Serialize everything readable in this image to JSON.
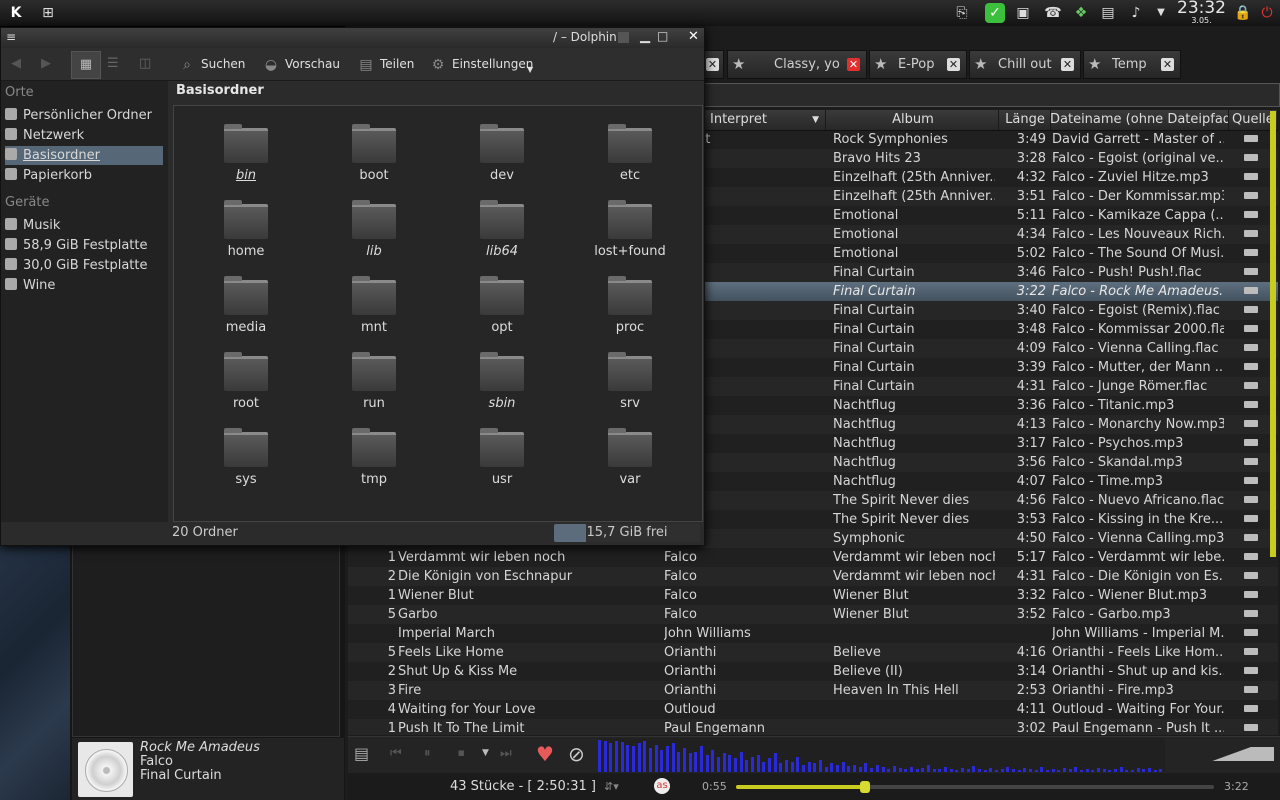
{
  "panel": {
    "clock_time": "23:32",
    "clock_date": "3.05."
  },
  "player": {
    "tabs": [
      {
        "label": "Classy, yo",
        "close_red": true
      },
      {
        "label": "E-Pop",
        "close_red": false
      },
      {
        "label": "Chill out",
        "close_red": false
      },
      {
        "label": "Temp",
        "close_red": false
      }
    ],
    "columns": {
      "artist": "Interpret",
      "album": "Album",
      "length": "Länge",
      "filename": "Dateiname (ohne Dateipfad)",
      "source": "Quelle"
    },
    "rows": [
      {
        "n": "",
        "title": "",
        "artist": "Garrett",
        "album": "Rock Symphonies",
        "len": "3:49",
        "file": "David Garrett - Master of ..."
      },
      {
        "n": "",
        "title": "",
        "artist": "",
        "album": "Bravo Hits 23",
        "len": "3:28",
        "file": "Falco - Egoist (original ve..."
      },
      {
        "n": "",
        "title": "",
        "artist": "",
        "album": "Einzelhaft (25th Anniver...",
        "len": "4:32",
        "file": "Falco - Zuviel Hitze.mp3"
      },
      {
        "n": "",
        "title": "",
        "artist": "",
        "album": "Einzelhaft (25th Anniver...",
        "len": "3:51",
        "file": "Falco - Der Kommissar.mp3"
      },
      {
        "n": "",
        "title": "",
        "artist": "",
        "album": "Emotional",
        "len": "5:11",
        "file": "Falco - Kamikaze Cappa (..."
      },
      {
        "n": "",
        "title": "",
        "artist": "",
        "album": "Emotional",
        "len": "4:34",
        "file": "Falco - Les Nouveaux Rich..."
      },
      {
        "n": "",
        "title": "",
        "artist": "",
        "album": "Emotional",
        "len": "5:02",
        "file": "Falco - The Sound Of Musi..."
      },
      {
        "n": "",
        "title": "",
        "artist": "",
        "album": "Final Curtain",
        "len": "3:46",
        "file": "Falco - Push! Push!.flac"
      },
      {
        "n": "",
        "title": "",
        "artist": "",
        "album": "Final Curtain",
        "len": "3:22",
        "file": "Falco - Rock Me Amadeus.f...",
        "current": true
      },
      {
        "n": "",
        "title": "",
        "artist": "",
        "album": "Final Curtain",
        "len": "3:40",
        "file": "Falco - Egoist (Remix).flac"
      },
      {
        "n": "",
        "title": "",
        "artist": "",
        "album": "Final Curtain",
        "len": "3:48",
        "file": "Falco - Kommissar 2000.flac"
      },
      {
        "n": "",
        "title": "",
        "artist": "",
        "album": "Final Curtain",
        "len": "4:09",
        "file": "Falco - Vienna Calling.flac"
      },
      {
        "n": "",
        "title": "",
        "artist": "",
        "album": "Final Curtain",
        "len": "3:39",
        "file": "Falco - Mutter, der Mann ..."
      },
      {
        "n": "",
        "title": "",
        "artist": "",
        "album": "Final Curtain",
        "len": "4:31",
        "file": "Falco - Junge Römer.flac"
      },
      {
        "n": "",
        "title": "",
        "artist": "",
        "album": "Nachtflug",
        "len": "3:36",
        "file": "Falco - Titanic.mp3"
      },
      {
        "n": "",
        "title": "",
        "artist": "",
        "album": "Nachtflug",
        "len": "4:13",
        "file": "Falco - Monarchy Now.mp3"
      },
      {
        "n": "",
        "title": "",
        "artist": "",
        "album": "Nachtflug",
        "len": "3:17",
        "file": "Falco - Psychos.mp3"
      },
      {
        "n": "",
        "title": "",
        "artist": "",
        "album": "Nachtflug",
        "len": "3:56",
        "file": "Falco - Skandal.mp3"
      },
      {
        "n": "",
        "title": "",
        "artist": "",
        "album": "Nachtflug",
        "len": "4:07",
        "file": "Falco - Time.mp3"
      },
      {
        "n": "",
        "title": "",
        "artist": "",
        "album": "The Spirit Never dies",
        "len": "4:56",
        "file": "Falco - Nuevo Africano.flac"
      },
      {
        "n": "",
        "title": "",
        "artist": "",
        "album": "The Spirit Never dies",
        "len": "3:53",
        "file": "Falco - Kissing in the Kre..."
      },
      {
        "n": "",
        "title": "",
        "artist": "",
        "album": "Symphonic",
        "len": "4:50",
        "file": "Falco - Vienna Calling.mp3"
      },
      {
        "n": "1",
        "title": "Verdammt wir leben noch",
        "artist": "Falco",
        "album": "Verdammt wir leben noch",
        "len": "5:17",
        "file": "Falco - Verdammt wir lebe..."
      },
      {
        "n": "2",
        "title": "Die Königin von Eschnapur",
        "artist": "Falco",
        "album": "Verdammt wir leben noch",
        "len": "4:31",
        "file": "Falco - Die Königin von Es..."
      },
      {
        "n": "1",
        "title": "Wiener Blut",
        "artist": "Falco",
        "album": "Wiener Blut",
        "len": "3:32",
        "file": "Falco - Wiener Blut.mp3"
      },
      {
        "n": "5",
        "title": "Garbo",
        "artist": "Falco",
        "album": "Wiener Blut",
        "len": "3:52",
        "file": "Falco - Garbo.mp3"
      },
      {
        "n": "",
        "title": "Imperial March",
        "artist": "John Williams",
        "album": "",
        "len": "",
        "file": "John Williams - Imperial M..."
      },
      {
        "n": "5",
        "title": "Feels Like Home",
        "artist": "Orianthi",
        "album": "Believe",
        "len": "4:16",
        "file": "Orianthi - Feels Like Hom..."
      },
      {
        "n": "2",
        "title": "Shut Up & Kiss Me",
        "artist": "Orianthi",
        "album": "Believe (II)",
        "len": "3:14",
        "file": "Orianthi - Shut up and kis..."
      },
      {
        "n": "3",
        "title": "Fire",
        "artist": "Orianthi",
        "album": "Heaven In This Hell",
        "len": "2:53",
        "file": "Orianthi - Fire.mp3"
      },
      {
        "n": "4",
        "title": "Waiting for Your Love",
        "artist": "Outloud",
        "album": "",
        "len": "4:11",
        "file": "Outloud - Waiting For Your..."
      },
      {
        "n": "1",
        "title": "Push It To The Limit",
        "artist": "Paul Engemann",
        "album": "",
        "len": "3:02",
        "file": "Paul Engemann - Push It ..."
      }
    ],
    "visualizer_levels": [
      0.95,
      0.9,
      0.85,
      0.92,
      0.88,
      0.8,
      0.75,
      0.85,
      0.9,
      0.7,
      0.8,
      0.65,
      0.75,
      0.85,
      0.6,
      0.7,
      0.55,
      0.6,
      0.75,
      0.5,
      0.65,
      0.45,
      0.55,
      0.5,
      0.4,
      0.6,
      0.35,
      0.45,
      0.5,
      0.3,
      0.4,
      0.55,
      0.25,
      0.35,
      0.3,
      0.45,
      0.2,
      0.3,
      0.25,
      0.35,
      0.15,
      0.25,
      0.2,
      0.3,
      0.18,
      0.22,
      0.15,
      0.25,
      0.12,
      0.2,
      0.15,
      0.1,
      0.18,
      0.12,
      0.08,
      0.15,
      0.1,
      0.12,
      0.2,
      0.1,
      0.08,
      0.14,
      0.1,
      0.06,
      0.12,
      0.08,
      0.18,
      0.1,
      0.07,
      0.12,
      0.05,
      0.1,
      0.16,
      0.08,
      0.06,
      0.12,
      0.09,
      0.05,
      0.14,
      0.07,
      0.1,
      0.06,
      0.12,
      0.08,
      0.15,
      0.06,
      0.1,
      0.05,
      0.12,
      0.08,
      0.06,
      0.1,
      0.14,
      0.07,
      0.05,
      0.11,
      0.08,
      0.12,
      0.06,
      0.09
    ],
    "status": {
      "track_count": "43 Stücke - [ 2:50:31 ]",
      "elapsed": "0:55",
      "total": "3:22",
      "progress": 0.27
    },
    "now_playing": {
      "title": "Rock Me Amadeus",
      "artist": "Falco",
      "album": "Final Curtain"
    }
  },
  "dolphin": {
    "menu_glyph": "≡",
    "title": "/ – Dolphin",
    "toolbar": {
      "search": "Suchen",
      "preview": "Vorschau",
      "share": "Teilen",
      "settings": "Einstellungen"
    },
    "places_heading": "Orte",
    "places": [
      "Persönlicher Ordner",
      "Netzwerk",
      "Basisordner",
      "Papierkorb"
    ],
    "devices_heading": "Geräte",
    "devices": [
      "Musik",
      "58,9 GiB Festplatte",
      "30,0 GiB Festplatte",
      "Wine"
    ],
    "location": "Basisordner",
    "folders": [
      {
        "name": "bin",
        "link": true
      },
      {
        "name": "boot",
        "link": false
      },
      {
        "name": "dev",
        "link": false
      },
      {
        "name": "etc",
        "link": false
      },
      {
        "name": "home",
        "link": false
      },
      {
        "name": "lib",
        "link": true
      },
      {
        "name": "lib64",
        "link": true
      },
      {
        "name": "lost+found",
        "link": false
      },
      {
        "name": "media",
        "link": false
      },
      {
        "name": "mnt",
        "link": false
      },
      {
        "name": "opt",
        "link": false
      },
      {
        "name": "proc",
        "link": false
      },
      {
        "name": "root",
        "link": false
      },
      {
        "name": "run",
        "link": false
      },
      {
        "name": "sbin",
        "link": true
      },
      {
        "name": "srv",
        "link": false
      },
      {
        "name": "sys",
        "link": false
      },
      {
        "name": "tmp",
        "link": false
      },
      {
        "name": "usr",
        "link": false
      },
      {
        "name": "var",
        "link": false
      }
    ],
    "status": "20 Ordner",
    "free_space": "15,7 GiB frei",
    "free_used_fraction": 0.22
  }
}
